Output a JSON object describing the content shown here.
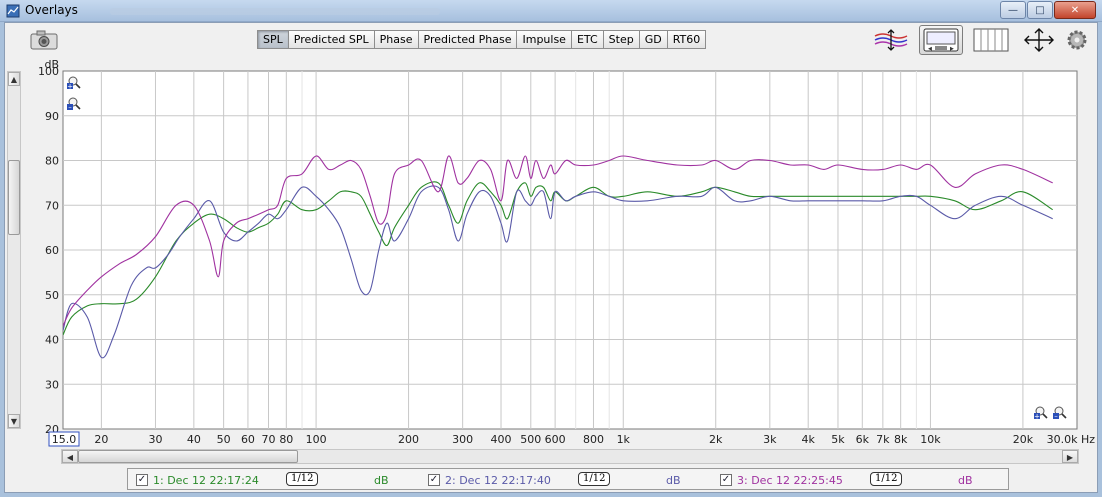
{
  "window": {
    "title": "Overlays"
  },
  "tabs": [
    {
      "label": "SPL",
      "active": true
    },
    {
      "label": "Predicted SPL",
      "active": false
    },
    {
      "label": "Phase",
      "active": false
    },
    {
      "label": "Predicted Phase",
      "active": false
    },
    {
      "label": "Impulse",
      "active": false
    },
    {
      "label": "ETC",
      "active": false
    },
    {
      "label": "Step",
      "active": false
    },
    {
      "label": "GD",
      "active": false
    },
    {
      "label": "RT60",
      "active": false
    }
  ],
  "toolbar": {
    "icons": [
      "traces-arrange-icon",
      "controls-panel-icon",
      "grid-lines-icon",
      "pan-arrows-icon",
      "settings-gear-icon"
    ]
  },
  "legend": {
    "items": [
      {
        "label": "1: Dec 12 22:17:24",
        "checked": true,
        "smoothing": "1/12",
        "unit": "dB",
        "color": "#2a8a2a"
      },
      {
        "label": "2: Dec 12 22:17:40",
        "checked": true,
        "smoothing": "1/12",
        "unit": "dB",
        "color": "#5a5aa8"
      },
      {
        "label": "3: Dec 12 22:25:45",
        "checked": true,
        "smoothing": "1/12",
        "unit": "dB",
        "color": "#a032a0"
      }
    ]
  },
  "chart_data": {
    "type": "line",
    "x_scale": "log",
    "xlabel": "Hz",
    "ylabel": "dB",
    "xlim": [
      15,
      30000
    ],
    "ylim": [
      20,
      100
    ],
    "y_ticks": [
      20,
      30,
      40,
      50,
      60,
      70,
      80,
      90,
      100
    ],
    "x_ticks": [
      {
        "v": 15,
        "label": "15.0"
      },
      {
        "v": 20,
        "label": "20"
      },
      {
        "v": 30,
        "label": "30"
      },
      {
        "v": 40,
        "label": "40"
      },
      {
        "v": 50,
        "label": "50"
      },
      {
        "v": 60,
        "label": "60"
      },
      {
        "v": 70,
        "label": "70"
      },
      {
        "v": 80,
        "label": "80"
      },
      {
        "v": 100,
        "label": "100"
      },
      {
        "v": 200,
        "label": "200"
      },
      {
        "v": 300,
        "label": "300"
      },
      {
        "v": 400,
        "label": "400"
      },
      {
        "v": 500,
        "label": "500"
      },
      {
        "v": 600,
        "label": "600"
      },
      {
        "v": 800,
        "label": "800"
      },
      {
        "v": 1000,
        "label": "1k"
      },
      {
        "v": 2000,
        "label": "2k"
      },
      {
        "v": 3000,
        "label": "3k"
      },
      {
        "v": 4000,
        "label": "4k"
      },
      {
        "v": 5000,
        "label": "5k"
      },
      {
        "v": 6000,
        "label": "6k"
      },
      {
        "v": 7000,
        "label": "7k"
      },
      {
        "v": 8000,
        "label": "8k"
      },
      {
        "v": 10000,
        "label": "10k"
      },
      {
        "v": 20000,
        "label": "20k"
      },
      {
        "v": 30000,
        "label": "30.0k Hz"
      }
    ],
    "grid": true,
    "series": [
      {
        "name": "1: Dec 12 22:17:24",
        "color": "#2a8a2a",
        "x": [
          15,
          16,
          18,
          20,
          23,
          26,
          30,
          35,
          40,
          45,
          50,
          55,
          60,
          65,
          70,
          75,
          80,
          90,
          100,
          110,
          120,
          130,
          140,
          150,
          160,
          170,
          180,
          200,
          220,
          250,
          270,
          290,
          310,
          340,
          370,
          400,
          420,
          450,
          480,
          500,
          520,
          550,
          580,
          600,
          650,
          700,
          800,
          900,
          1000,
          1200,
          1500,
          1800,
          2000,
          2300,
          2600,
          3000,
          3500,
          4000,
          4500,
          5000,
          6000,
          7000,
          8000,
          9000,
          10000,
          12000,
          14000,
          17000,
          20000,
          25000
        ],
        "y": [
          41,
          45,
          47.5,
          48,
          48,
          49,
          54,
          62,
          66,
          68,
          67,
          65,
          64,
          65,
          66,
          68,
          71,
          69,
          69,
          71,
          73,
          73,
          72,
          68,
          64,
          61,
          65,
          70,
          74,
          75,
          70,
          66,
          71,
          75,
          73,
          70,
          67,
          73,
          75,
          72,
          74,
          74,
          71,
          73,
          71,
          72,
          74,
          72,
          72,
          73,
          72,
          73,
          74,
          73,
          72,
          72,
          72,
          72,
          72,
          72,
          72,
          72,
          72,
          72,
          72,
          71,
          69,
          71,
          73,
          69
        ]
      },
      {
        "name": "2: Dec 12 22:17:40",
        "color": "#5a5aa8",
        "x": [
          15,
          16,
          18,
          20,
          22,
          25,
          28,
          30,
          33,
          36,
          40,
          45,
          50,
          55,
          60,
          65,
          70,
          75,
          80,
          90,
          100,
          110,
          120,
          130,
          140,
          150,
          160,
          170,
          180,
          200,
          220,
          250,
          270,
          290,
          310,
          340,
          370,
          400,
          420,
          450,
          480,
          500,
          520,
          550,
          580,
          600,
          650,
          700,
          800,
          900,
          1000,
          1200,
          1500,
          1800,
          2000,
          2300,
          2600,
          3000,
          3500,
          4000,
          4500,
          5000,
          6000,
          7000,
          8000,
          9000,
          10000,
          12000,
          14000,
          17000,
          20000,
          25000
        ],
        "y": [
          42,
          48,
          45,
          36,
          41,
          52,
          56,
          56,
          59,
          63,
          67,
          71,
          64,
          62,
          64,
          66,
          68,
          67,
          69,
          74,
          72,
          69,
          65,
          58,
          51,
          51,
          60,
          66,
          62,
          67,
          73,
          74,
          69,
          62,
          68,
          73,
          72,
          66,
          62,
          73,
          71,
          70,
          72,
          73,
          67,
          73,
          71,
          72,
          73,
          72,
          71,
          71,
          72,
          72,
          74,
          71,
          71,
          72,
          71,
          71,
          71,
          71,
          71,
          71,
          72,
          72,
          70,
          67,
          70,
          72,
          70,
          67
        ]
      },
      {
        "name": "3: Dec 12 22:25:45",
        "color": "#a032a0",
        "x": [
          15,
          16,
          18,
          20,
          23,
          26,
          30,
          35,
          40,
          45,
          48,
          50,
          55,
          60,
          65,
          70,
          75,
          80,
          90,
          100,
          110,
          120,
          130,
          140,
          150,
          160,
          170,
          180,
          200,
          220,
          250,
          270,
          290,
          310,
          340,
          370,
          400,
          420,
          450,
          480,
          500,
          520,
          550,
          580,
          600,
          650,
          700,
          800,
          900,
          1000,
          1200,
          1500,
          1800,
          2000,
          2300,
          2600,
          3000,
          3500,
          4000,
          4500,
          5000,
          6000,
          7000,
          8000,
          9000,
          10000,
          12000,
          14000,
          17000,
          20000,
          25000
        ],
        "y": [
          43,
          47,
          51,
          54,
          57,
          59,
          63,
          70,
          70,
          62,
          54,
          62,
          66,
          67,
          68,
          69,
          70,
          76,
          77,
          81,
          78,
          79,
          80,
          78,
          72,
          66,
          68,
          77,
          79,
          80,
          73,
          81,
          75,
          76,
          80,
          78,
          71,
          80,
          76,
          81,
          76,
          80,
          76,
          79,
          77,
          80,
          79,
          79,
          80,
          81,
          80,
          79,
          79,
          80,
          78,
          80,
          80,
          79,
          79,
          78,
          79,
          78,
          78,
          79,
          78,
          79,
          74,
          77,
          79,
          78,
          75
        ]
      }
    ]
  }
}
